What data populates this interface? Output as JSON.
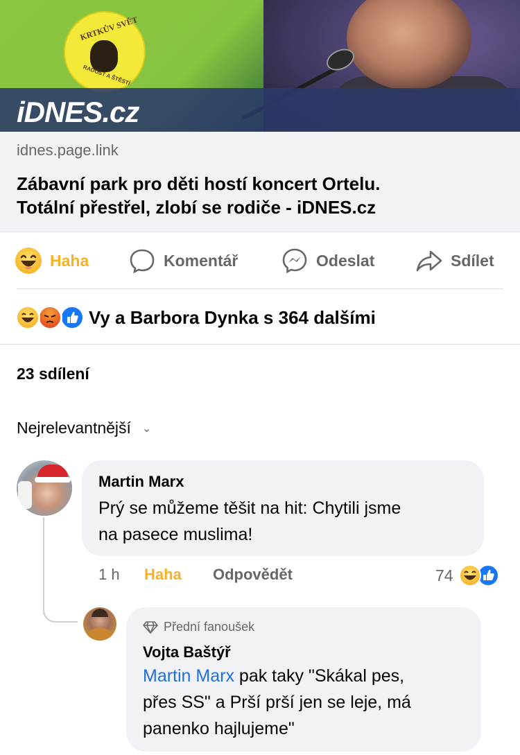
{
  "preview": {
    "brand": "iDNES.cz",
    "logo_top_text": "KRTKŮV SVĚT",
    "logo_bottom_text": "RADOST A ŠTĚSTÍ"
  },
  "link": {
    "domain": "idnes.page.link",
    "title_line1": "Zábavní park pro děti hostí koncert Ortelu.",
    "title_line2": "Totální přestřel, zlobí se rodiče - iDNES.cz"
  },
  "actions": {
    "haha": "Haha",
    "comment": "Komentář",
    "send": "Odeslat",
    "share": "Sdílet"
  },
  "reactions": {
    "summary": "Vy a Barbora Dynka s 364 dalšími",
    "icons": [
      "haha-icon",
      "angry-icon",
      "like-icon"
    ]
  },
  "shares": "23 sdílení",
  "sort": {
    "label": "Nejrelevantnější"
  },
  "comments": [
    {
      "author": "Martin Marx",
      "text_line1": "Prý se můžeme těšit na hit: Chytili jsme",
      "text_line2": "na pasece muslima!",
      "time": "1 h",
      "haha": "Haha",
      "reply": "Odpovědět",
      "reaction_count": "74"
    }
  ],
  "reply": {
    "badge": "Přední fanoušek",
    "author": "Vojta Baštýř",
    "mention": "Martin Marx",
    "text_line1_rest": " pak taky \"Skákal pes,",
    "text_line2": "přes SS\" a Prší prší jen se leje, má",
    "text_line3": "panenko hajlujeme\""
  },
  "colors": {
    "haha": "#f7b125",
    "like": "#1877f2",
    "angry": "#e9710f",
    "muted": "#65676b",
    "link": "#216fdb",
    "brand_bar": "#2b3a69"
  }
}
